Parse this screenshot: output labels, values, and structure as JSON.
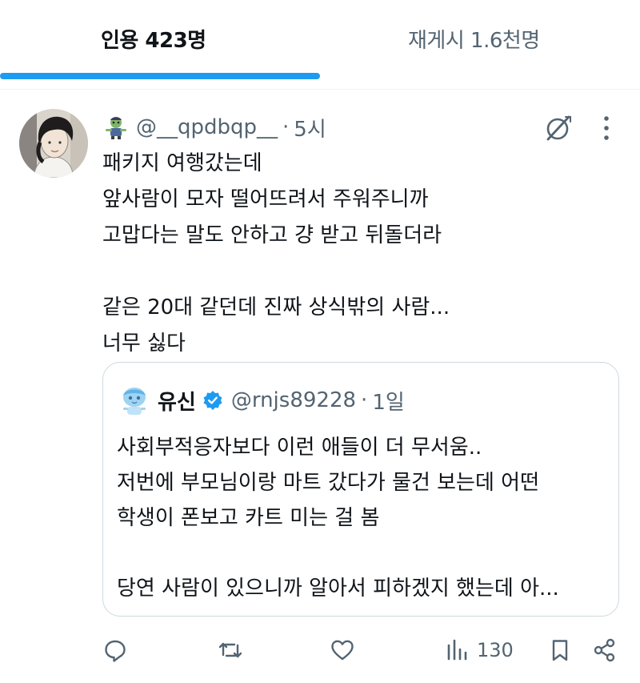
{
  "tabs": [
    {
      "label": "인용 423명",
      "active": true
    },
    {
      "label": "재게시 1.6천명",
      "active": false
    }
  ],
  "colors": {
    "accent": "#1d9bf0",
    "text": "#0f1419",
    "secondary": "#536471",
    "border": "#cfd9de"
  },
  "tweet": {
    "author_emoji": "zombie-emoji-icon",
    "handle": "@__qpdbqp__",
    "separator": "·",
    "time": "5시",
    "lines": [
      "패키지 여행갔는데",
      "앞사람이 모자 떨어뜨려서 주워주니까",
      "고맙다는 말도 안하고 걍 받고 뒤돌더라",
      "",
      "같은 20대 같던데 진짜 상식밖의 사람...",
      "너무 싫다"
    ]
  },
  "quote": {
    "name": "유신",
    "verified": true,
    "handle": "@rnjs89228",
    "separator": "·",
    "time": "1일",
    "lines": [
      "사회부적응자보다 이런 애들이 더 무서움..",
      "저번에 부모님이랑 마트 갔다가 물건 보는데 어떤",
      "학생이 폰보고 카트 미는 걸 봄",
      "",
      "당연 사람이 있으니까 알아서 피하겠지 했는데 아..."
    ]
  },
  "actions": {
    "reply": "reply-icon",
    "repost": "repost-icon",
    "like": "heart-icon",
    "views_count": "130",
    "bookmark": "bookmark-icon",
    "share": "share-icon"
  }
}
